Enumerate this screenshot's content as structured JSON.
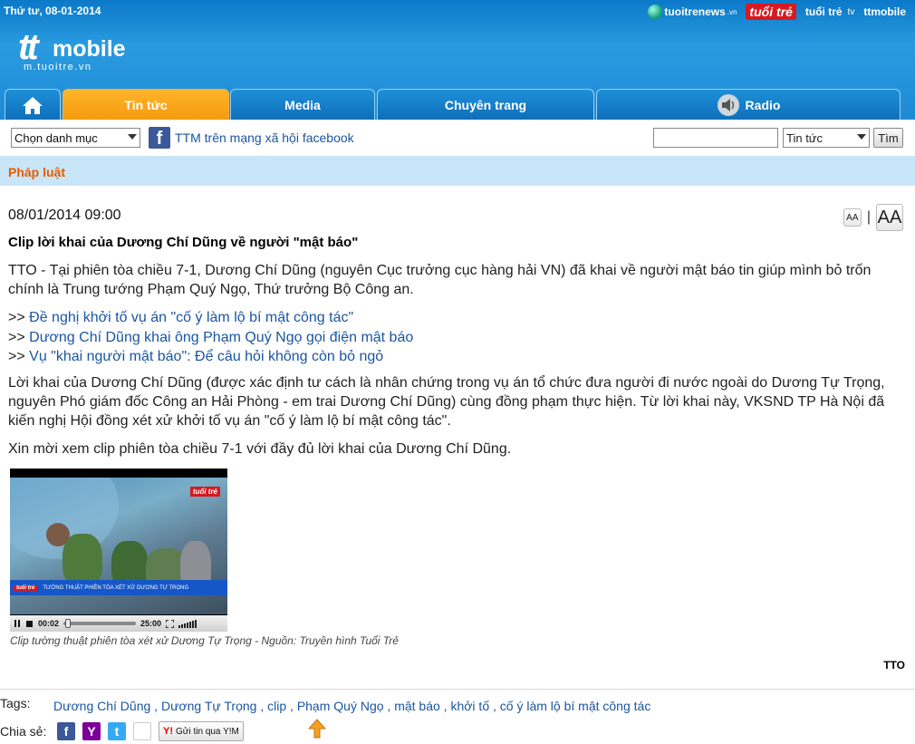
{
  "topbar": {
    "date": "Thứ tư, 08-01-2014",
    "partners": {
      "tuoitrenews": "tuoitrenews",
      "tuoitrenews_suffix": ".vn",
      "tuoitre": "tuổi trẻ",
      "tuoitre_tv": "tuổi trẻ",
      "tv": "tv",
      "ttmobile": "ttmobile"
    }
  },
  "logo": {
    "tt": "tt",
    "mobile": "mobile",
    "url": "m.tuoitre.vn"
  },
  "nav": {
    "tabs": [
      {
        "label": "Tin tức"
      },
      {
        "label": "Media"
      },
      {
        "label": "Chuyên trang"
      },
      {
        "label": "Radio"
      }
    ]
  },
  "toolbar": {
    "category_select": "Chọn danh mục",
    "facebook_link": "TTM trên mạng xã hội facebook",
    "search_value": "",
    "section_select": "Tin tức",
    "search_button": "Tìm"
  },
  "category": {
    "title": "Pháp luật"
  },
  "article": {
    "date": "08/01/2014 09:00",
    "font_small": "AA",
    "font_sep": "|",
    "font_big": "AA",
    "headline": "Clip lời khai của Dương Chí Dũng về người \"mật báo\"",
    "lead": "TTO - Tại phiên tòa chiều 7-1, Dương Chí Dũng (nguyên Cục trưởng cục hàng hải VN) đã khai về người mật báo tin giúp mình bỏ trốn chính là Trung tướng Phạm Quý Ngọ, Thứ trưởng Bộ Công an.",
    "related_prefix": ">>",
    "related": [
      "Đề nghị khởi tố vụ án \"cố ý làm lộ bí mật công tác\"",
      "Dương Chí Dũng khai ông Phạm Quý Ngọ gọi điện mật báo",
      "Vụ \"khai người mật báo\": Để câu hỏi không còn bỏ ngỏ"
    ],
    "body": "Lời khai của Dương Chí Dũng (được xác định tư cách là nhân chứng trong vụ án tổ chức đưa người đi nước ngoài do Dương Tự Trọng, nguyên Phó giám đốc Công an Hải Phòng - em trai Dương Chí Dũng) cùng đồng phạm thực hiện. Từ lời khai này, VKSND TP Hà Nội đã kiến nghị Hội đồng xét xử khởi tố vụ án \"cố ý làm lộ bí mật công tác\".",
    "invite": "Xin mời xem clip phiên tòa chiều 7-1 với đầy đủ lời khai của Dương Chí Dũng.",
    "video": {
      "current_time": "00:02",
      "duration": "25:00",
      "banner_logo": "tuổi trẻ",
      "banner_text": "TƯỜNG THUẬT PHIÊN TÒA XÉT XỬ DƯƠNG TỰ TRỌNG",
      "corner_logo": "tuổi trẻ"
    },
    "caption": "Clip tường thuật phiên tòa xét xử Dương Tự Trọng - Nguồn: Truyền hình Tuổi Trẻ",
    "source": "TTO"
  },
  "footer": {
    "tags_label": "Tags:",
    "tags": [
      "Dương Chí Dũng",
      "Dương Tự Trọng",
      "clip",
      "Phạm Quý Ngọ",
      "mật báo",
      "khởi tố",
      "cố ý làm lộ bí mật công tác"
    ],
    "share_label": "Chia sẻ:",
    "ym_button": "Gửi tin qua Y!M",
    "ym_logo": "Y!"
  },
  "colors": {
    "header_blue": "#1c8ad6",
    "nav_active": "#f59a0e",
    "category_strip": "#c8e6f8",
    "category_title": "#e65c00",
    "link": "#1a56a0"
  }
}
